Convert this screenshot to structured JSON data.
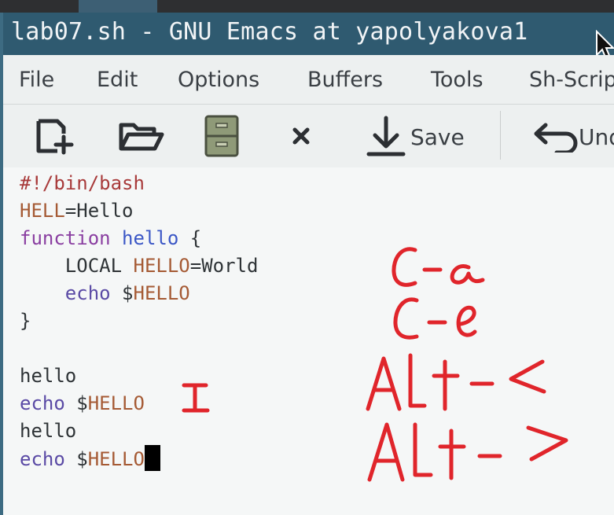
{
  "window": {
    "title": "lab07.sh - GNU Emacs at yapolyakova1"
  },
  "menu": [
    "File",
    "Edit",
    "Options",
    "Buffers",
    "Tools",
    "Sh-Script"
  ],
  "toolbar": {
    "save_label": "Save",
    "undo_label": "Undo"
  },
  "code": {
    "line1": "#!/bin/bash",
    "l2_var": "HELL",
    "l2_eq": "=Hello",
    "l3_kw": "function",
    "l3_name": "hello",
    "l3_brace": " {",
    "l4_local": "LOCAL ",
    "l4_var": "HELLO",
    "l4_eq": "=World",
    "l5_echo": "echo",
    "l5_dollar": " $",
    "l5_var": "HELLO",
    "l6": "}",
    "l8": "hello",
    "l9_echo": "echo",
    "l9_dollar": " $",
    "l9_var": "HELLO",
    "l10": "hello",
    "l11_echo": "echo",
    "l11_dollar": " $",
    "l11_var": "HELLO"
  },
  "annotations": [
    "C-a",
    "C-e",
    "Alt-<",
    "Alt->"
  ],
  "colors": {
    "title_bar": "#2f5a70",
    "annotation_ink": "#e0252b",
    "editor_bg": "#f5f7f7"
  }
}
